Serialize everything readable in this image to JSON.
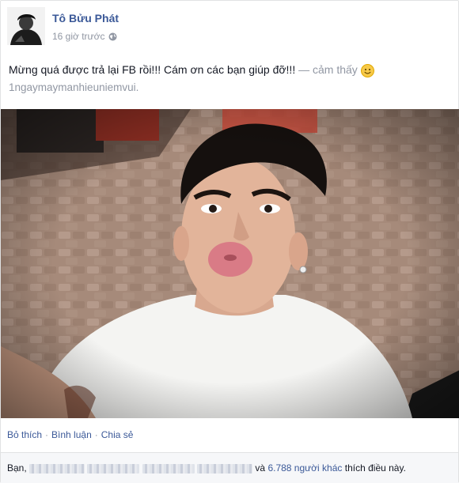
{
  "post": {
    "author": "Tô Bửu Phát",
    "time": "16 giờ trước",
    "privacy_icon": "globe-icon",
    "status_text": "Mừng quá được trả lại FB rồi!!! Cám ơn các bạn giúp đỡ!!!",
    "feeling": "— cảm thấy",
    "feeling_icon": "smile-emoji-icon",
    "hashtag": "1ngaymaymanhieuniemvui."
  },
  "actions": {
    "like": "Bỏ thích",
    "comment": "Bình luận",
    "share": "Chia sẻ",
    "separator": "·"
  },
  "likes": {
    "prefix": "Bạn,",
    "conjunction": "và",
    "others": "6.788 người khác",
    "suffix": "thích điều này."
  },
  "colors": {
    "link": "#3b5998",
    "muted": "#9197a3",
    "text": "#141823",
    "likes_bg": "#f6f7f9"
  }
}
